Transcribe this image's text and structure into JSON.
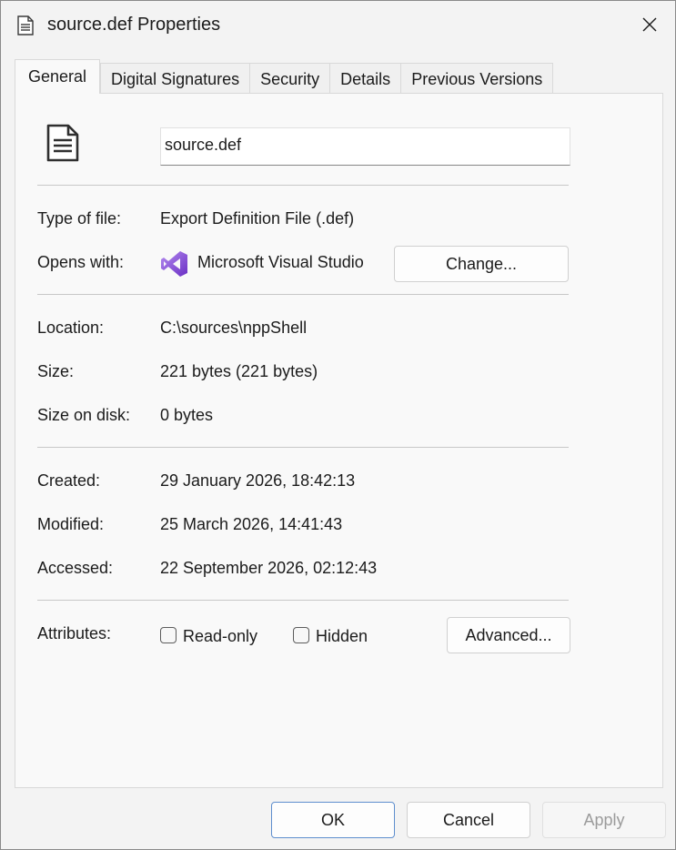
{
  "window": {
    "title": "source.def Properties"
  },
  "tabs": [
    {
      "label": "General",
      "active": true
    },
    {
      "label": "Digital Signatures",
      "active": false
    },
    {
      "label": "Security",
      "active": false
    },
    {
      "label": "Details",
      "active": false
    },
    {
      "label": "Previous Versions",
      "active": false
    }
  ],
  "general": {
    "file_name": "source.def",
    "type_label": "Type of file:",
    "type_value": "Export Definition File (.def)",
    "opens_label": "Opens with:",
    "opens_value": "Microsoft Visual Studio",
    "change_button": "Change...",
    "location_label": "Location:",
    "location_value": "C:\\sources\\nppShell",
    "size_label": "Size:",
    "size_value": "221 bytes (221 bytes)",
    "size_on_disk_label": "Size on disk:",
    "size_on_disk_value": "0 bytes",
    "created_label": "Created:",
    "created_value": "29 January 2026, 18:42:13",
    "modified_label": "Modified:",
    "modified_value": "25 March 2026, 14:41:43",
    "accessed_label": "Accessed:",
    "accessed_value": "22 September 2026, 02:12:43",
    "attributes_label": "Attributes:",
    "readonly_label": "Read-only",
    "readonly_checked": false,
    "hidden_label": "Hidden",
    "hidden_checked": false,
    "advanced_button": "Advanced..."
  },
  "footer": {
    "ok": "OK",
    "cancel": "Cancel",
    "apply": "Apply"
  },
  "colors": {
    "window_bg": "#f3f3f3",
    "panel_bg": "#f9f9f9",
    "primary_border": "#5f8fce",
    "vs_purple": "#8a4fd8"
  },
  "icons": [
    "document-icon",
    "close-icon",
    "file-icon",
    "visual-studio-icon"
  ]
}
